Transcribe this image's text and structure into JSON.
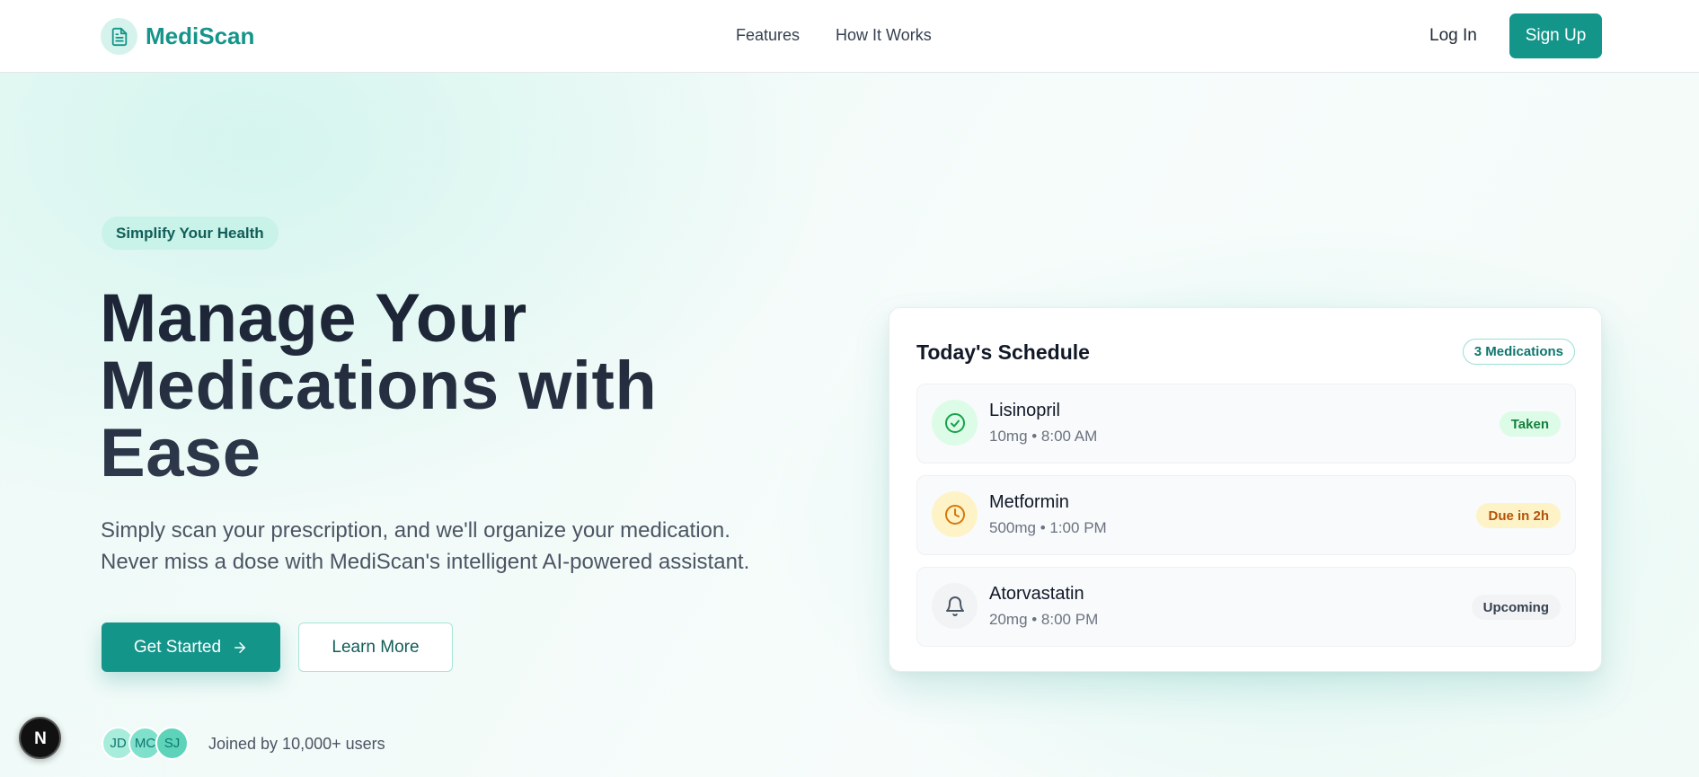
{
  "nav": {
    "logo_text": "MediScan",
    "links": [
      "Features",
      "How It Works"
    ],
    "login_label": "Log In",
    "signup_label": "Sign Up"
  },
  "hero": {
    "badge": "Simplify Your Health",
    "headline_lines": [
      "Manage Your",
      "Medications with",
      "Ease"
    ],
    "subtext_lines": [
      "Simply scan your prescription, and we'll organize your medication.",
      "Never miss a dose with MediScan's intelligent AI-powered assistant."
    ],
    "primary_button": "Get Started",
    "secondary_button": "Learn More",
    "avatars": [
      "JD",
      "MC",
      "SJ"
    ],
    "joined_text": "Joined by 10,000+ users"
  },
  "schedule": {
    "title": "Today's Schedule",
    "count_badge": "3 Medications",
    "items": [
      {
        "name": "Lisinopril",
        "detail": "10mg • 8:00 AM",
        "status": "Taken",
        "icon": "check-circle-icon"
      },
      {
        "name": "Metformin",
        "detail": "500mg • 1:00 PM",
        "status": "Due in 2h",
        "icon": "clock-icon"
      },
      {
        "name": "Atorvastatin",
        "detail": "20mg • 8:00 PM",
        "status": "Upcoming",
        "icon": "bell-icon"
      }
    ]
  },
  "floating_badge": "N",
  "colors": {
    "brand": "#14958a",
    "brand_dark": "#0f766e",
    "taken_bg": "#dcfce7",
    "taken_text": "#15803d",
    "due_bg": "#fef3c7",
    "due_text": "#b45309",
    "upcoming_bg": "#f1f3f5",
    "upcoming_text": "#374151"
  }
}
